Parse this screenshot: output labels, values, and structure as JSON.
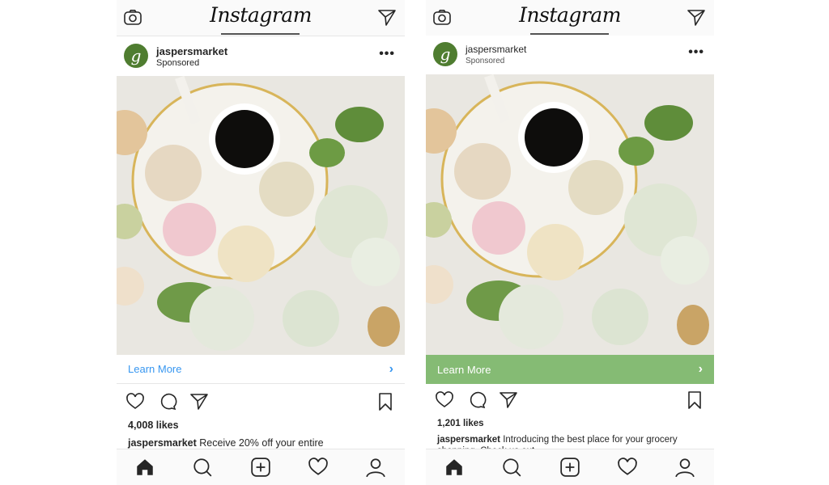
{
  "screens": [
    {
      "app_title": "Instagram",
      "account": "jaspersmarket",
      "sponsored_label": "Sponsored",
      "avatar_letter": "g",
      "cta_label": "Learn More",
      "cta_arrow": "›",
      "cta_style": "plain",
      "likes": "4,008 likes",
      "caption_user": "jaspersmarket",
      "caption_text": " Receive 20% off your entire"
    },
    {
      "app_title": "Instagram",
      "account": "jaspersmarket",
      "sponsored_label": "Sponsored",
      "avatar_letter": "g",
      "cta_label": "Learn More",
      "cta_arrow": "›",
      "cta_style": "green-banner",
      "cta_color": "#85bb74",
      "likes": "1,201 likes",
      "caption_user": "jaspersmarket",
      "caption_text": " Introducing the best place for your grocery shopping. Check us out"
    }
  ],
  "icons": {
    "top_left": "camera-icon",
    "top_right": "direct-message-icon",
    "post_menu": "more-options-icon",
    "actions": [
      "heart-icon",
      "comment-icon",
      "share-icon",
      "bookmark-icon"
    ],
    "nav": [
      "home-icon",
      "search-icon",
      "add-post-icon",
      "activity-heart-icon",
      "profile-icon"
    ]
  },
  "colors": {
    "link_blue": "#3897f0",
    "cta_green": "#85bb74",
    "avatar_green": "#4f7d30"
  },
  "more_glyph": "•••"
}
